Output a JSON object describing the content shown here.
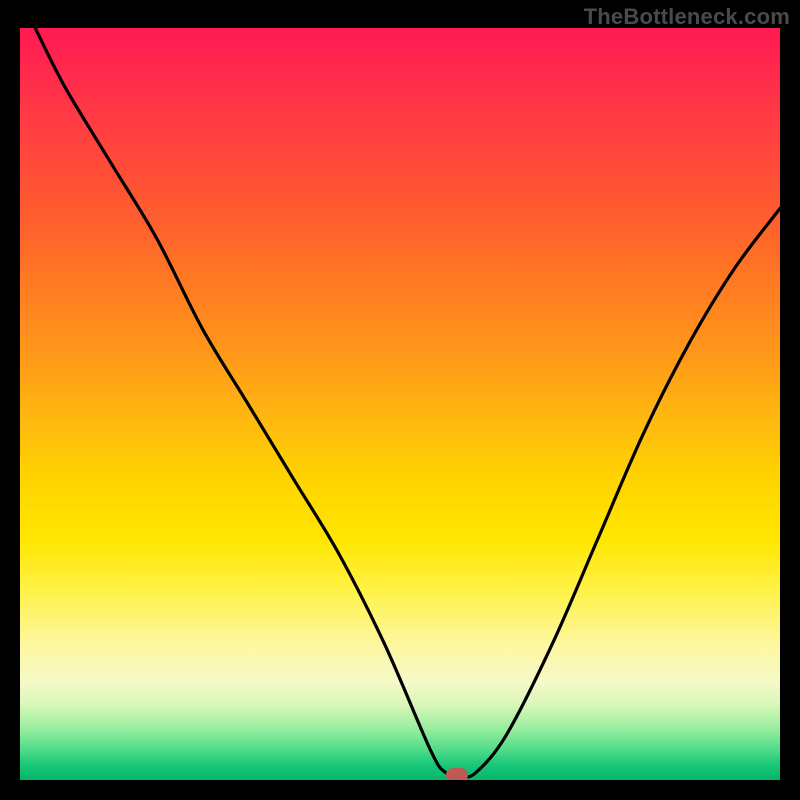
{
  "watermark": "TheBottleneck.com",
  "colors": {
    "frame_bg": "#000000",
    "curve": "#000000",
    "marker": "#bb5a56",
    "watermark_text": "#4a4a4a"
  },
  "chart_data": {
    "type": "line",
    "title": "",
    "xlabel": "",
    "ylabel": "",
    "xlim": [
      0,
      100
    ],
    "ylim": [
      0,
      100
    ],
    "grid": false,
    "legend": false,
    "note": "V-shaped bottleneck curve: steep decline from top-left, flat minimum near x≈57, then rises toward top-right. Axes unlabeled; values read as percentage of plot area.",
    "series": [
      {
        "name": "bottleneck_curve",
        "x": [
          2,
          6,
          12,
          18,
          24,
          30,
          36,
          42,
          48,
          54,
          56,
          58,
          60,
          64,
          70,
          76,
          82,
          88,
          94,
          100
        ],
        "y": [
          100,
          92,
          82,
          72,
          60,
          50,
          40,
          30,
          18,
          4,
          1,
          0.5,
          1,
          6,
          18,
          32,
          46,
          58,
          68,
          76
        ]
      }
    ],
    "marker": {
      "x": 57.5,
      "y": 0.7
    },
    "background_gradient_stops": [
      {
        "pos": 0,
        "color": "#ff1a54"
      },
      {
        "pos": 24,
        "color": "#ff5a30"
      },
      {
        "pos": 52,
        "color": "#ffb810"
      },
      {
        "pos": 75,
        "color": "#fff24a"
      },
      {
        "pos": 90,
        "color": "#d8f7b8"
      },
      {
        "pos": 100,
        "color": "#05b56a"
      }
    ]
  }
}
